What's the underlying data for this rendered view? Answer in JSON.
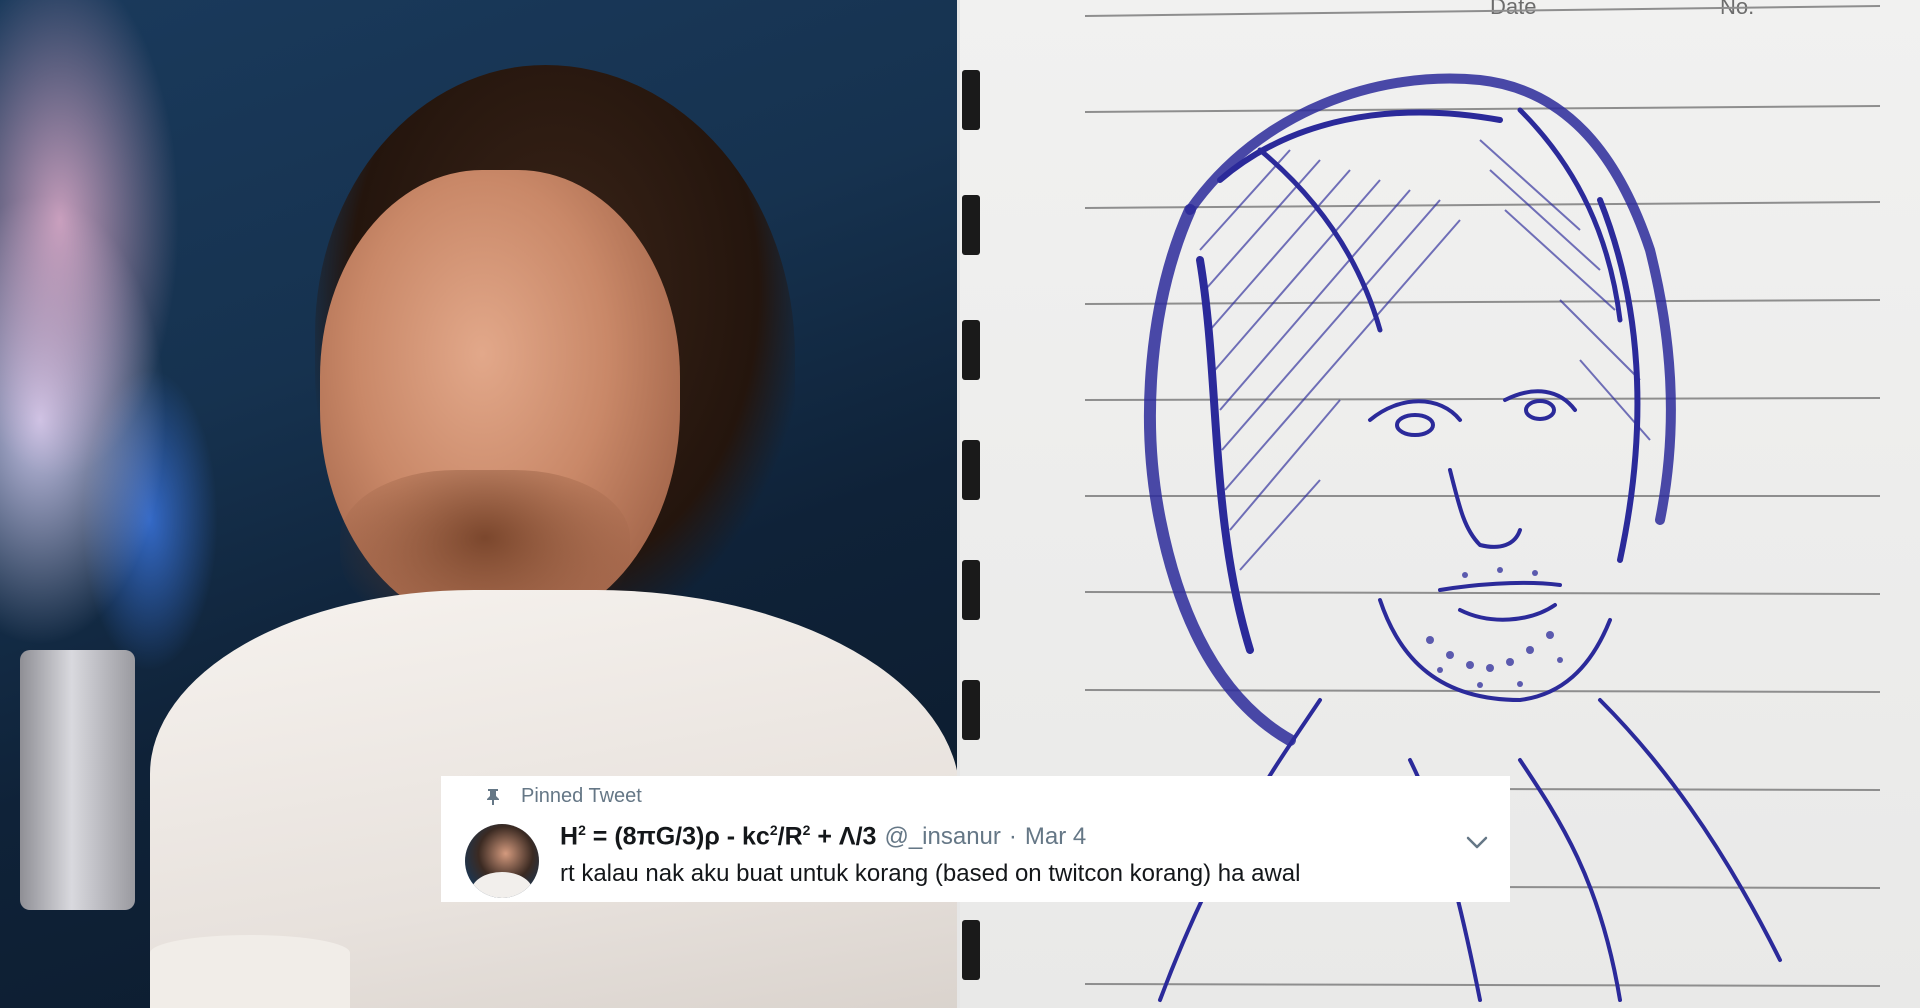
{
  "sketch_page": {
    "date_label": "Date",
    "no_label": "No."
  },
  "tweet": {
    "pinned_label": "Pinned Tweet",
    "display_name": {
      "part1": "H",
      "sup1": "2",
      "part2": " = (8πG/3)ρ - kc",
      "sup2": "2",
      "part3": "/R",
      "sup3": "2",
      "part4": " + Λ/3"
    },
    "handle": "@_insanur",
    "separator": "·",
    "date": "Mar 4",
    "text": "rt kalau nak aku buat untuk korang (based on twitcon korang) ha awal",
    "icons": {
      "pin": "pin-icon",
      "menu": "chevron-down-icon",
      "avatar": "avatar"
    }
  },
  "colors": {
    "ink": "#2b2a9a",
    "secondary_text": "#657786",
    "primary_text": "#14171a",
    "paper": "#eeeeed"
  }
}
